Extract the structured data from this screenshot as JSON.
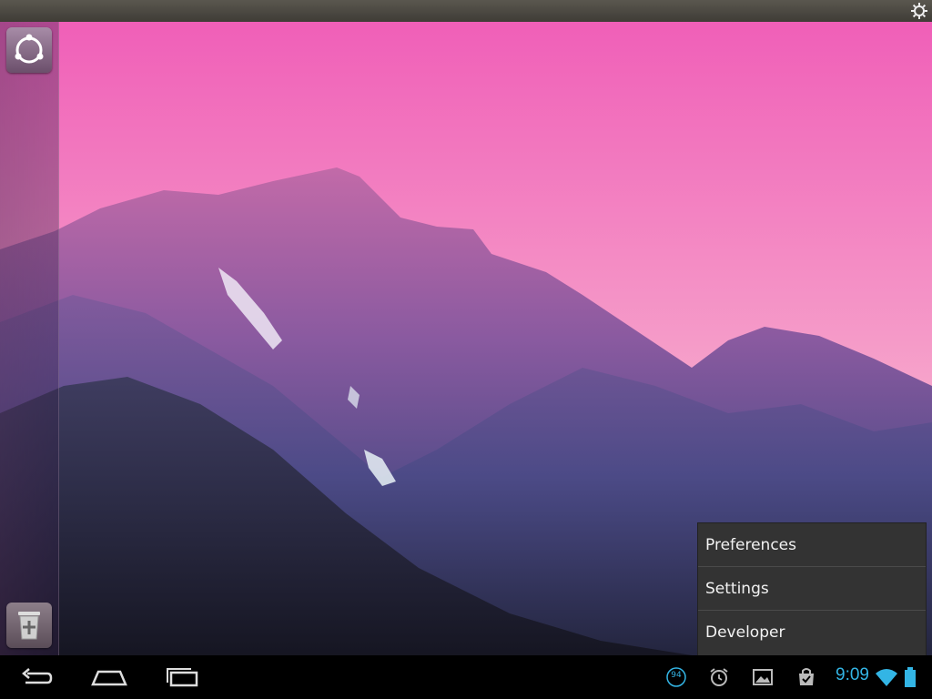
{
  "context_menu": {
    "items": [
      {
        "label": "Preferences"
      },
      {
        "label": "Settings"
      },
      {
        "label": "Developer"
      }
    ]
  },
  "status_bar": {
    "clock": "9:09",
    "notification_badge": "94",
    "icons": [
      "notification-count-icon",
      "alarm-icon",
      "gallery-icon",
      "store-icon",
      "wifi-icon",
      "battery-icon"
    ]
  },
  "nav_bar": {
    "buttons": [
      "back-icon",
      "home-icon",
      "recent-apps-icon"
    ]
  },
  "launcher": {
    "items": [
      "ubuntu-dash-icon",
      "trash-icon"
    ]
  },
  "colors": {
    "accent": "#33b5e5",
    "menu_bg": "#333333",
    "sky_top": "#f05fb8",
    "sky_bottom": "#f7c7d5"
  }
}
